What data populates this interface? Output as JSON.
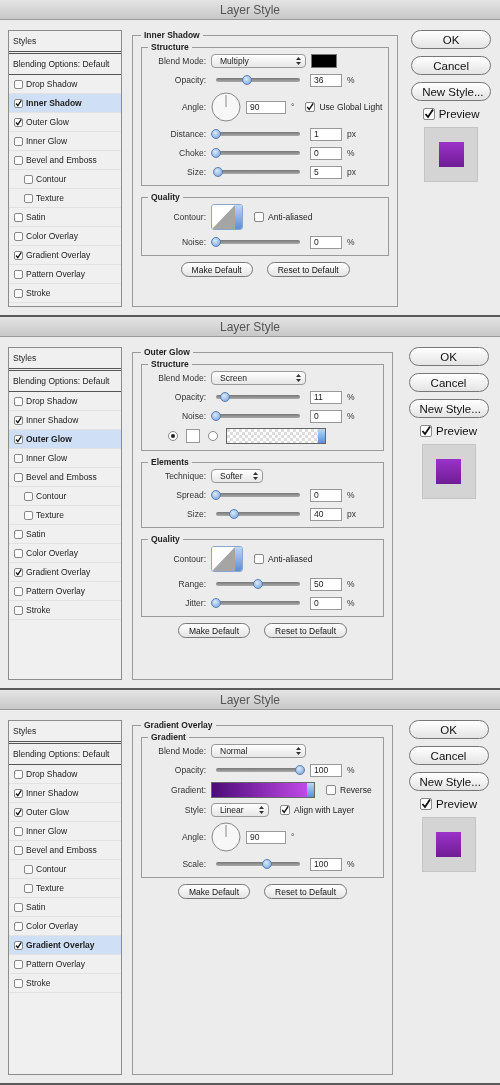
{
  "dialogs": [
    {
      "title": "Layer Style",
      "styles_header": "Styles",
      "blending": "Blending Options: Default",
      "effects": [
        {
          "label": "Drop Shadow",
          "checked": false,
          "selected": false
        },
        {
          "label": "Inner Shadow",
          "checked": true,
          "selected": true
        },
        {
          "label": "Outer Glow",
          "checked": true,
          "selected": false
        },
        {
          "label": "Inner Glow",
          "checked": false,
          "selected": false
        },
        {
          "label": "Bevel and Emboss",
          "checked": false,
          "selected": false,
          "children": [
            {
              "label": "Contour",
              "checked": false,
              "selected": false
            },
            {
              "label": "Texture",
              "checked": false,
              "selected": false
            }
          ]
        },
        {
          "label": "Satin",
          "checked": false,
          "selected": false
        },
        {
          "label": "Color Overlay",
          "checked": false,
          "selected": false
        },
        {
          "label": "Gradient Overlay",
          "checked": true,
          "selected": false
        },
        {
          "label": "Pattern Overlay",
          "checked": false,
          "selected": false
        },
        {
          "label": "Stroke",
          "checked": false,
          "selected": false
        }
      ],
      "panel": {
        "title": "Inner Shadow",
        "sections": [
          {
            "title": "Structure",
            "rows": [
              {
                "kind": "select",
                "label": "Blend Mode:",
                "value": "Multiply",
                "color": "#000000"
              },
              {
                "kind": "slider",
                "label": "Opacity:",
                "level": 0.37,
                "value": "36",
                "unit": "%"
              },
              {
                "kind": "angle",
                "label": "Angle:",
                "value": "90",
                "unit": "°",
                "option": {
                  "label": "Use Global Light",
                  "checked": true
                }
              },
              {
                "kind": "slider",
                "label": "Distance:",
                "level": 0,
                "value": "1",
                "unit": "px"
              },
              {
                "kind": "slider",
                "label": "Choke:",
                "level": 0,
                "value": "0",
                "unit": "%"
              },
              {
                "kind": "slider",
                "label": "Size:",
                "level": 0.02,
                "value": "5",
                "unit": "px"
              }
            ]
          },
          {
            "title": "Quality",
            "rows": [
              {
                "kind": "contour",
                "label": "Contour:",
                "option": {
                  "label": "Anti-aliased",
                  "checked": false
                }
              },
              {
                "kind": "slider",
                "label": "Noise:",
                "level": 0,
                "value": "0",
                "unit": "%"
              }
            ]
          }
        ],
        "buttons": [
          "Make Default",
          "Reset to Default"
        ]
      },
      "actions": [
        "OK",
        "Cancel",
        "New Style..."
      ],
      "preview": {
        "label": "Preview",
        "checked": true
      }
    },
    {
      "title": "Layer Style",
      "styles_header": "Styles",
      "blending": "Blending Options: Default",
      "effects": [
        {
          "label": "Drop Shadow",
          "checked": false,
          "selected": false
        },
        {
          "label": "Inner Shadow",
          "checked": true,
          "selected": false
        },
        {
          "label": "Outer Glow",
          "checked": true,
          "selected": true
        },
        {
          "label": "Inner Glow",
          "checked": false,
          "selected": false
        },
        {
          "label": "Bevel and Emboss",
          "checked": false,
          "selected": false,
          "children": [
            {
              "label": "Contour",
              "checked": false,
              "selected": false
            },
            {
              "label": "Texture",
              "checked": false,
              "selected": false
            }
          ]
        },
        {
          "label": "Satin",
          "checked": false,
          "selected": false
        },
        {
          "label": "Color Overlay",
          "checked": false,
          "selected": false
        },
        {
          "label": "Gradient Overlay",
          "checked": true,
          "selected": false
        },
        {
          "label": "Pattern Overlay",
          "checked": false,
          "selected": false
        },
        {
          "label": "Stroke",
          "checked": false,
          "selected": false
        }
      ],
      "panel": {
        "title": "Outer Glow",
        "sections": [
          {
            "title": "Structure",
            "rows": [
              {
                "kind": "select",
                "label": "Blend Mode:",
                "value": "Screen"
              },
              {
                "kind": "slider",
                "label": "Opacity:",
                "level": 0.11,
                "value": "11",
                "unit": "%"
              },
              {
                "kind": "slider",
                "label": "Noise:",
                "level": 0,
                "value": "0",
                "unit": "%"
              },
              {
                "kind": "source",
                "choices": [
                  {
                    "kind": "color",
                    "selected": true,
                    "color": "#ffffff"
                  },
                  {
                    "kind": "gradient",
                    "selected": false
                  }
                ]
              }
            ]
          },
          {
            "title": "Elements",
            "rows": [
              {
                "kind": "select",
                "label": "Technique:",
                "value": "Softer"
              },
              {
                "kind": "slider",
                "label": "Spread:",
                "level": 0,
                "value": "0",
                "unit": "%"
              },
              {
                "kind": "slider",
                "label": "Size:",
                "level": 0.21,
                "value": "40",
                "unit": "px"
              }
            ]
          },
          {
            "title": "Quality",
            "rows": [
              {
                "kind": "contour",
                "label": "Contour:",
                "option": {
                  "label": "Anti-aliased",
                  "checked": false
                }
              },
              {
                "kind": "slider",
                "label": "Range:",
                "level": 0.5,
                "value": "50",
                "unit": "%"
              },
              {
                "kind": "slider",
                "label": "Jitter:",
                "level": 0,
                "value": "0",
                "unit": "%"
              }
            ]
          }
        ],
        "buttons": [
          "Make Default",
          "Reset to Default"
        ]
      },
      "actions": [
        "OK",
        "Cancel",
        "New Style..."
      ],
      "preview": {
        "label": "Preview",
        "checked": true
      }
    },
    {
      "title": "Layer Style",
      "styles_header": "Styles",
      "blending": "Blending Options: Default",
      "effects": [
        {
          "label": "Drop Shadow",
          "checked": false,
          "selected": false
        },
        {
          "label": "Inner Shadow",
          "checked": true,
          "selected": false
        },
        {
          "label": "Outer Glow",
          "checked": true,
          "selected": false
        },
        {
          "label": "Inner Glow",
          "checked": false,
          "selected": false
        },
        {
          "label": "Bevel and Emboss",
          "checked": false,
          "selected": false,
          "children": [
            {
              "label": "Contour",
              "checked": false,
              "selected": false
            },
            {
              "label": "Texture",
              "checked": false,
              "selected": false
            }
          ]
        },
        {
          "label": "Satin",
          "checked": false,
          "selected": false
        },
        {
          "label": "Color Overlay",
          "checked": false,
          "selected": false
        },
        {
          "label": "Gradient Overlay",
          "checked": true,
          "selected": true
        },
        {
          "label": "Pattern Overlay",
          "checked": false,
          "selected": false
        },
        {
          "label": "Stroke",
          "checked": false,
          "selected": false
        }
      ],
      "panel": {
        "title": "Gradient Overlay",
        "sections": [
          {
            "title": "Gradient",
            "rows": [
              {
                "kind": "select",
                "label": "Blend Mode:",
                "value": "Normal"
              },
              {
                "kind": "slider",
                "label": "Opacity:",
                "level": 1,
                "value": "100",
                "unit": "%"
              },
              {
                "kind": "gradient",
                "label": "Gradient:",
                "option": {
                  "label": "Reverse",
                  "checked": false
                }
              },
              {
                "kind": "select",
                "label": "Style:",
                "value": "Linear",
                "option": {
                  "label": "Align with Layer",
                  "checked": true
                }
              },
              {
                "kind": "angle",
                "label": "Angle:",
                "value": "90",
                "unit": "°"
              },
              {
                "kind": "slider",
                "label": "Scale:",
                "level": 0.61,
                "value": "100",
                "unit": "%"
              }
            ]
          }
        ],
        "buttons": [
          "Make Default",
          "Reset to Default"
        ]
      },
      "actions": [
        "OK",
        "Cancel",
        "New Style..."
      ],
      "preview": {
        "label": "Preview",
        "checked": true
      }
    }
  ]
}
